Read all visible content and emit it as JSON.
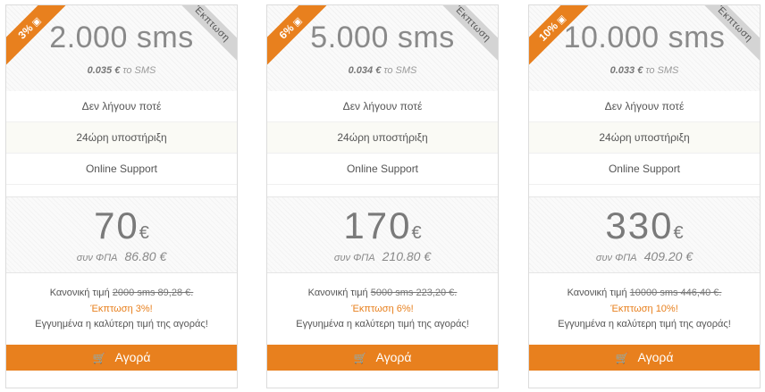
{
  "cards": [
    {
      "discount_badge": "3%",
      "badge_icon": "gift-icon",
      "corner_label": "Έκπτωση",
      "sms_count": "2.000",
      "sms_unit": "sms",
      "rate_value": "0.035 €",
      "rate_suffix": "το SMS",
      "features": [
        "Δεν λήγουν ποτέ",
        "24ώρη υποστήριξη",
        "Online Support"
      ],
      "price": "70",
      "currency": "€",
      "vat_label": "συν ΦΠΑ",
      "vat_price": "86.80 €",
      "regular_label": "Κανονική τιμή",
      "regular_value": "2000 sms 89,28 €.",
      "discount_text": "Έκπτωση 3%!",
      "guarantee": "Εγγυημένα η καλύτερη τιμή της αγοράς!",
      "buy_label": "Αγορά"
    },
    {
      "discount_badge": "6%",
      "badge_icon": "gift-icon",
      "corner_label": "Έκπτωση",
      "sms_count": "5.000",
      "sms_unit": "sms",
      "rate_value": "0.034 €",
      "rate_suffix": "το SMS",
      "features": [
        "Δεν λήγουν ποτέ",
        "24ώρη υποστήριξη",
        "Online Support"
      ],
      "price": "170",
      "currency": "€",
      "vat_label": "συν ΦΠΑ",
      "vat_price": "210.80 €",
      "regular_label": "Κανονική τιμή",
      "regular_value": "5000 sms 223,20 €.",
      "discount_text": "Έκπτωση 6%!",
      "guarantee": "Εγγυημένα η καλύτερη τιμή της αγοράς!",
      "buy_label": "Αγορά"
    },
    {
      "discount_badge": "10%",
      "badge_icon": "gift-icon",
      "corner_label": "Έκπτωση",
      "sms_count": "10.000",
      "sms_unit": "sms",
      "rate_value": "0.033 €",
      "rate_suffix": "το SMS",
      "features": [
        "Δεν λήγουν ποτέ",
        "24ώρη υποστήριξη",
        "Online Support"
      ],
      "price": "330",
      "currency": "€",
      "vat_label": "συν ΦΠΑ",
      "vat_price": "409.20 €",
      "regular_label": "Κανονική τιμή",
      "regular_value": "10000 sms 446,40 €.",
      "discount_text": "Έκπτωση 10%!",
      "guarantee": "Εγγυημένα η καλύτερη τιμή της αγοράς!",
      "buy_label": "Αγορά"
    }
  ],
  "icons": {
    "badge": "gift-icon",
    "buy": "cart-icon"
  },
  "colors": {
    "accent": "#e8801e",
    "corner_ribbon": "#d4d4d4",
    "text": "#555555"
  }
}
